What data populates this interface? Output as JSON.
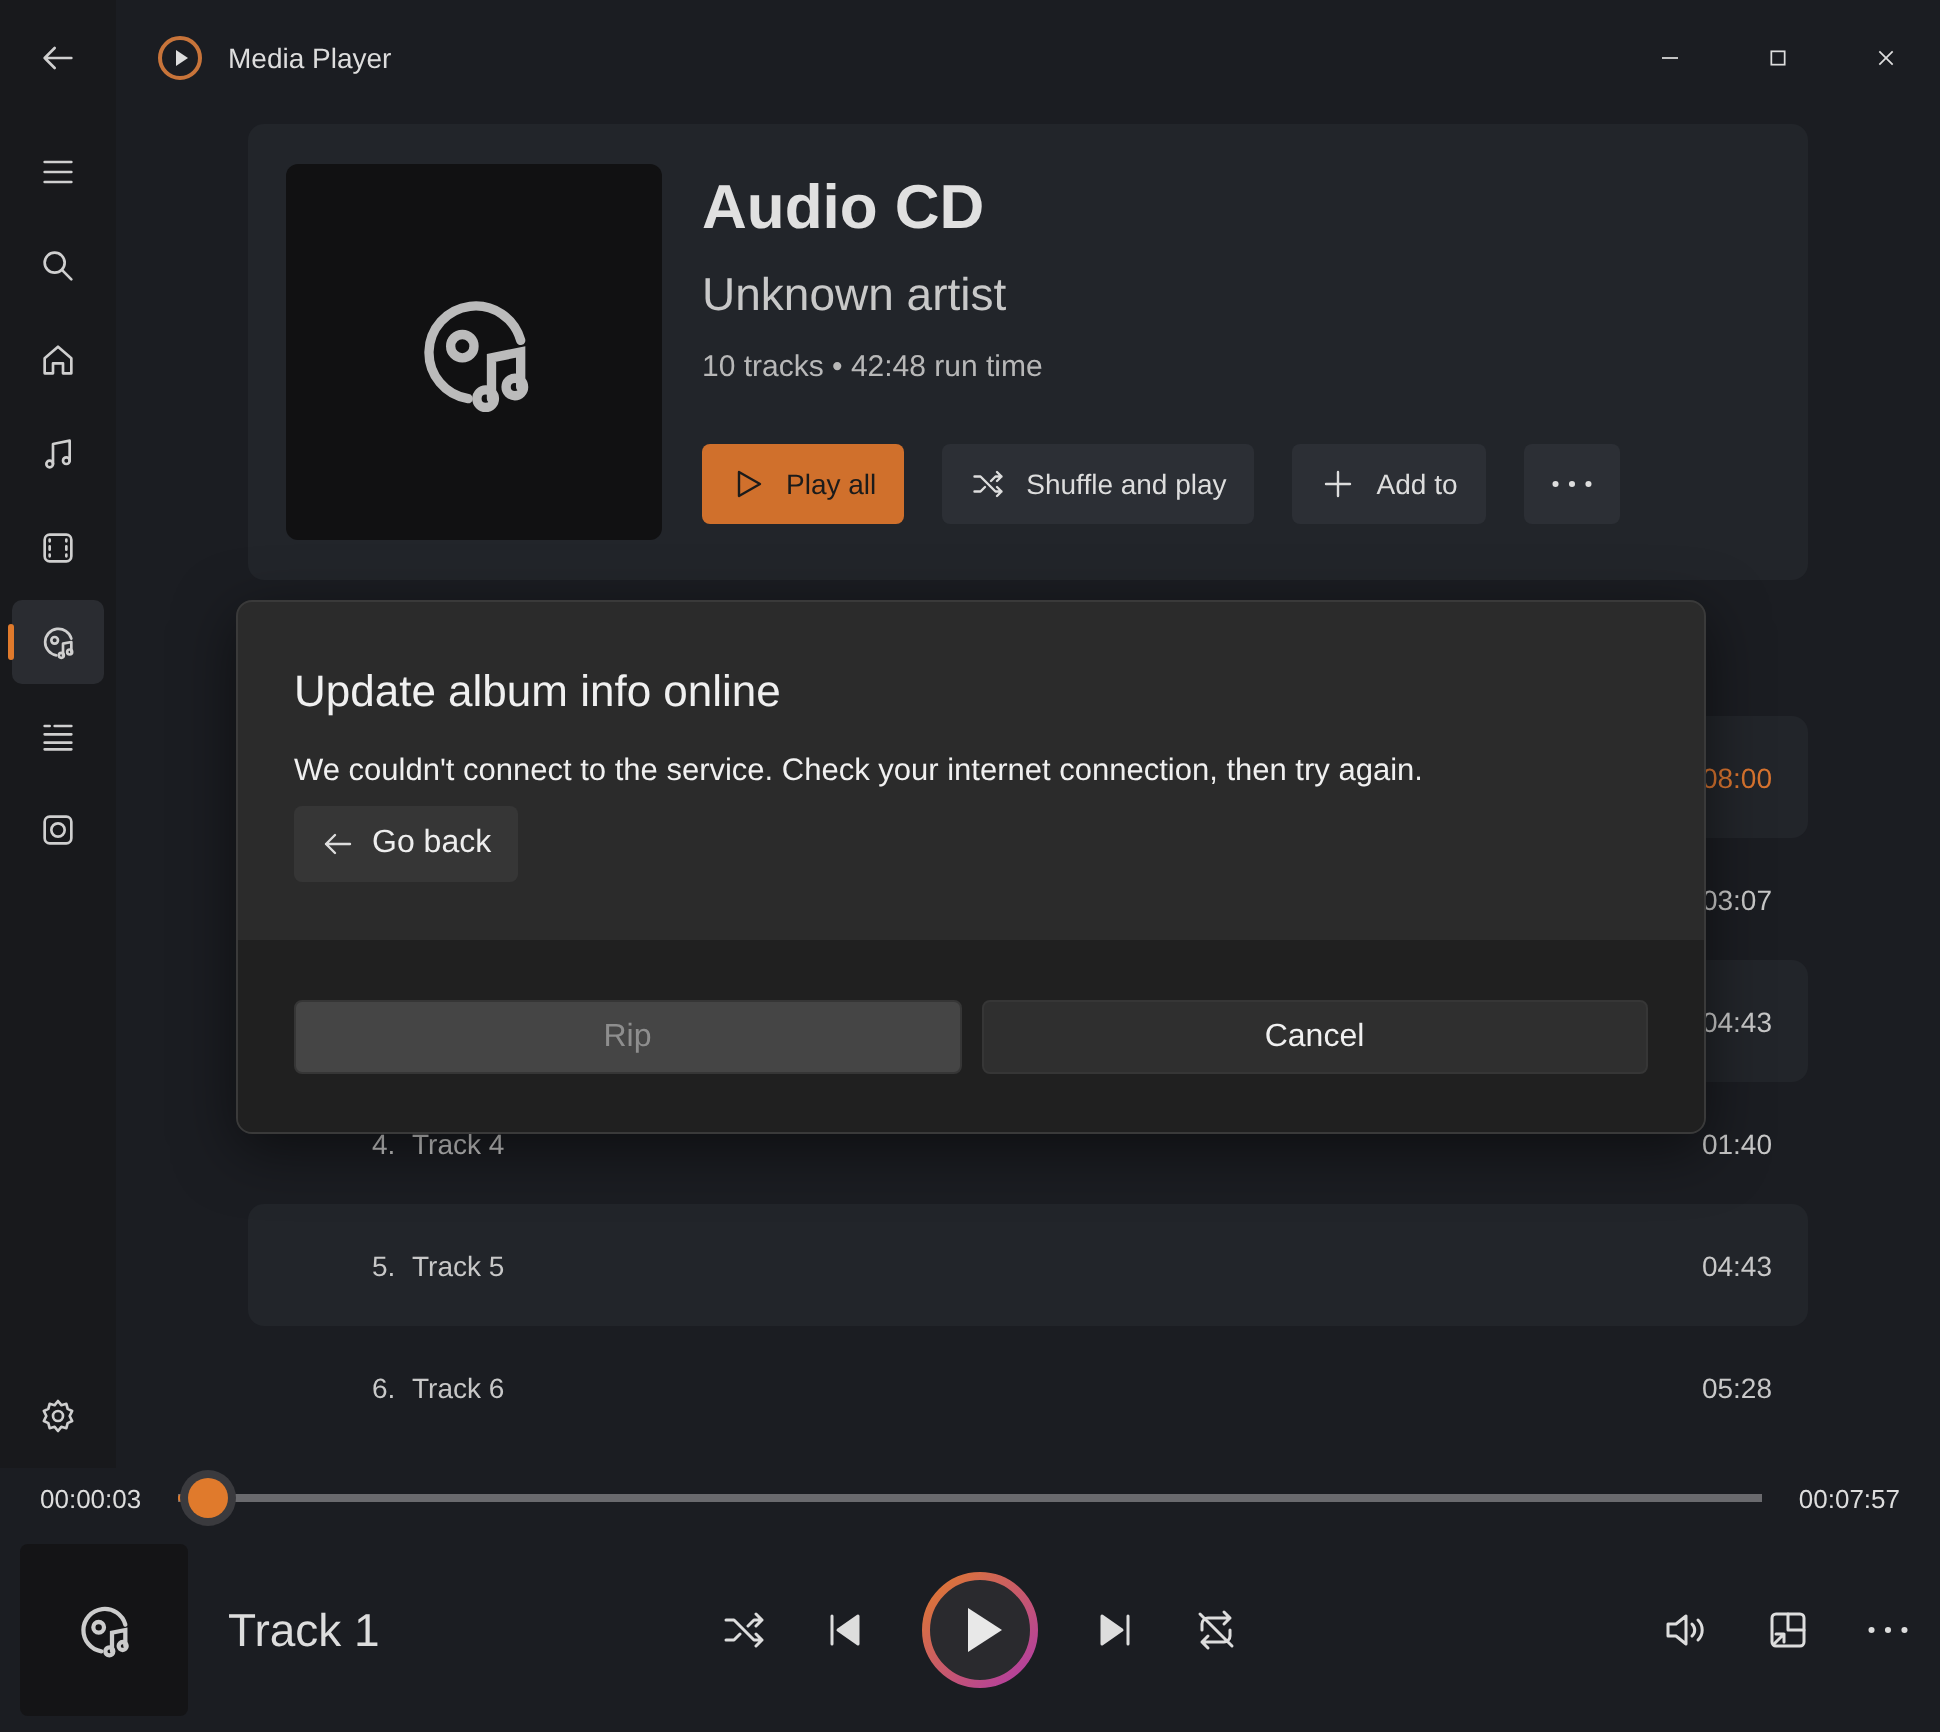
{
  "window": {
    "title": "Media Player"
  },
  "sidebar": {
    "items": [
      {
        "kind": "menu",
        "selected": false
      },
      {
        "kind": "search",
        "selected": false
      },
      {
        "kind": "home",
        "selected": false
      },
      {
        "kind": "music",
        "selected": false
      },
      {
        "kind": "video",
        "selected": false
      },
      {
        "kind": "disc",
        "selected": true
      },
      {
        "kind": "queue",
        "selected": false
      },
      {
        "kind": "drive",
        "selected": false
      }
    ]
  },
  "album": {
    "title": "Audio CD",
    "artist": "Unknown artist",
    "meta": "10 tracks • 42:48 run time",
    "actions": [
      {
        "kind": "play",
        "label": "Play all",
        "primary": true
      },
      {
        "kind": "shuffle",
        "label": "Shuffle and play",
        "primary": false
      },
      {
        "kind": "add",
        "label": "Add to",
        "primary": false
      },
      {
        "kind": "more",
        "primary": false
      }
    ]
  },
  "tracks": [
    {
      "duration": "08:00",
      "playing": true
    },
    {
      "duration": "03:07",
      "playing": false
    },
    {
      "duration": "04:43",
      "playing": false
    },
    {
      "number": "4.",
      "title": "Track 4",
      "duration": "01:40",
      "playing": false
    },
    {
      "number": "5.",
      "title": "Track 5",
      "duration": "04:43",
      "playing": false
    },
    {
      "number": "6.",
      "title": "Track 6",
      "duration": "05:28",
      "playing": false
    }
  ],
  "dialog": {
    "title": "Update album info online",
    "message": "We couldn't connect to the service. Check your internet connection, then try again.",
    "link": "Go back",
    "buttons": [
      {
        "label": "Rip",
        "disabled": true
      },
      {
        "label": "Cancel",
        "disabled": false
      }
    ]
  },
  "player": {
    "elapsed": "00:00:03",
    "total": "00:07:57",
    "level": 0.02,
    "now_playing": "Track 1"
  }
}
